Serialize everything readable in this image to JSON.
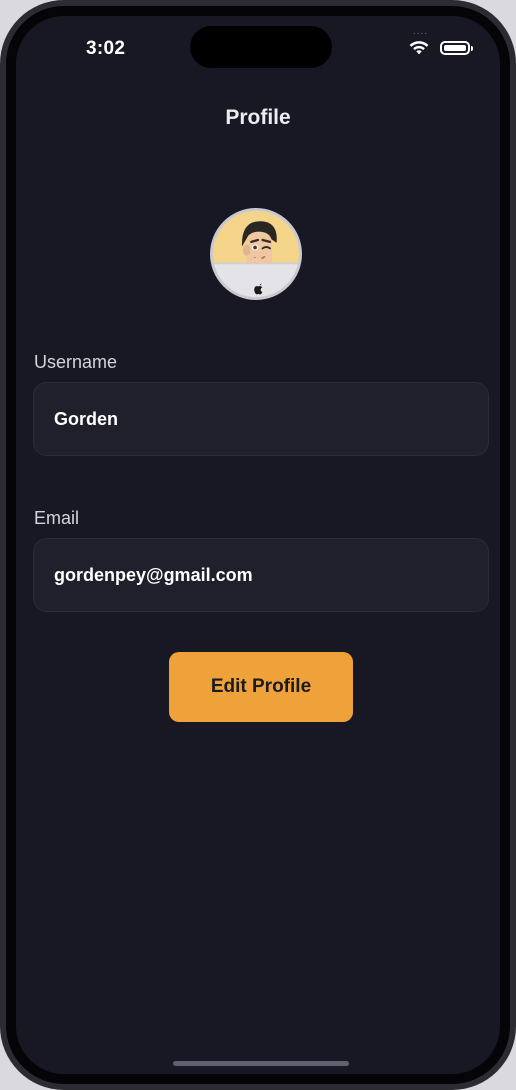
{
  "status_bar": {
    "time": "3:02",
    "signal": "....",
    "icons": [
      "wifi-icon",
      "battery-icon"
    ]
  },
  "header": {
    "title": "Profile"
  },
  "avatar": {
    "description": "memoji-avatar",
    "badge_icon": "apple-logo-icon"
  },
  "form": {
    "username": {
      "label": "Username",
      "value": "Gorden"
    },
    "email": {
      "label": "Email",
      "value": "gordenpey@gmail.com"
    }
  },
  "actions": {
    "edit_label": "Edit Profile"
  },
  "colors": {
    "background": "#171823",
    "field_background": "#1f202b",
    "accent": "#f0a23a",
    "text": "#ffffff"
  }
}
